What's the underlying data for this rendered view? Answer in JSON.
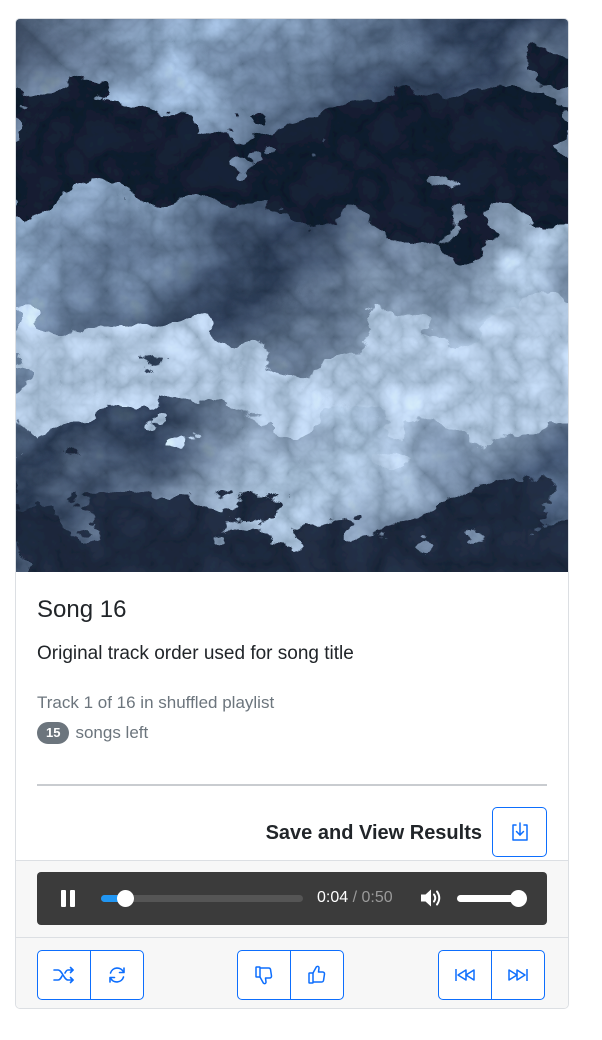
{
  "song": {
    "title": "Song 16",
    "subtitle": "Original track order used for song title",
    "track_info": "Track 1 of 16 in shuffled playlist",
    "songs_left_count": "15",
    "songs_left_label": "songs left"
  },
  "actions": {
    "save_label": "Save and View Results"
  },
  "player": {
    "state": "playing",
    "current_time": "0:04",
    "separator": " / ",
    "duration": "0:50",
    "progress": 0.12,
    "volume": 1.0
  },
  "colors": {
    "accent": "#0d6efd",
    "progress": "#2196f3",
    "player_bg": "#3b3b3b",
    "badge_bg": "#6c757d"
  },
  "icons": {
    "save": "download-icon",
    "shuffle": "shuffle-icon",
    "repeat": "repeat-icon",
    "dislike": "thumbs-down-icon",
    "like": "thumbs-up-icon",
    "previous": "skip-back-icon",
    "next": "skip-forward-icon",
    "play": "pause-icon",
    "volume": "volume-icon"
  }
}
